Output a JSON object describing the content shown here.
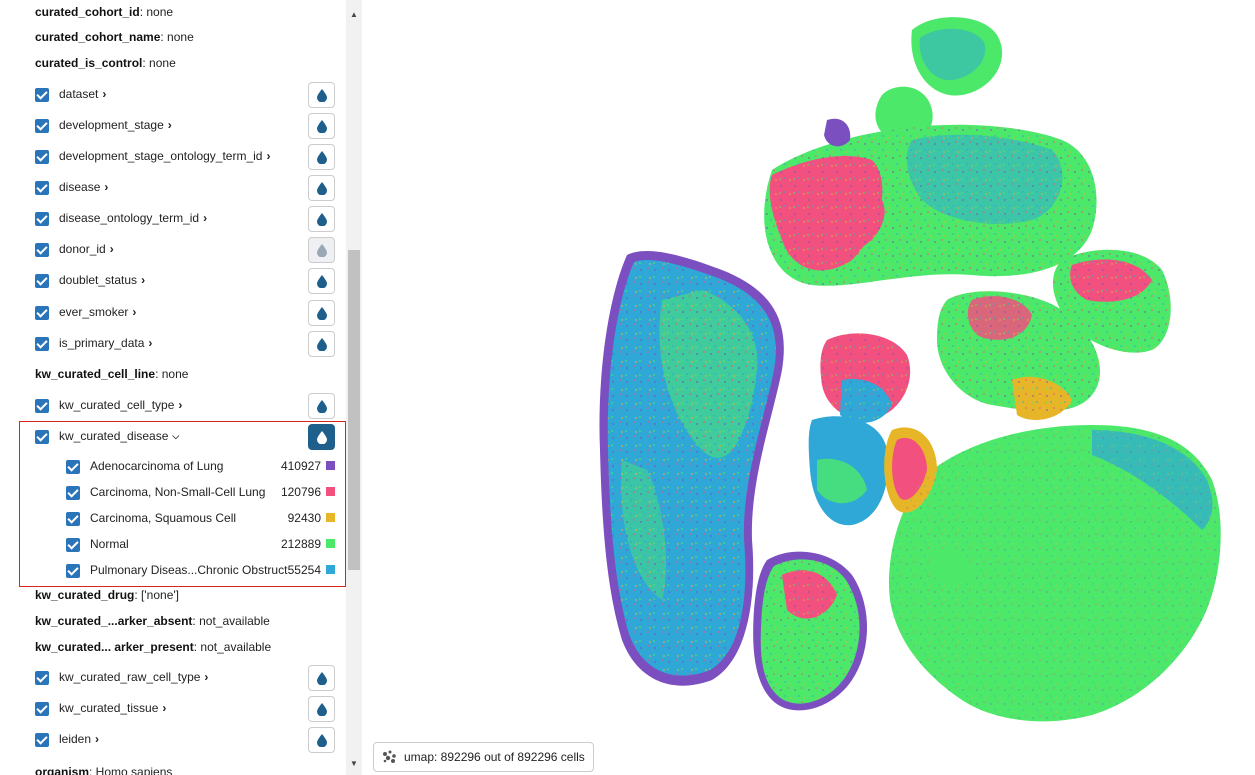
{
  "sidebar": {
    "partial_top": {
      "key": "curated_cohort_id",
      "value": ": none"
    },
    "curated_cohort_name": {
      "key": "curated_cohort_name",
      "value": ": none"
    },
    "curated_is_control": {
      "key": "curated_is_control",
      "value": ": none"
    },
    "fields": [
      {
        "label": "dataset"
      },
      {
        "label": "development_stage"
      },
      {
        "label": "development_stage_ontology_term_id"
      },
      {
        "label": "disease"
      },
      {
        "label": "disease_ontology_term_id"
      },
      {
        "label": "donor_id"
      },
      {
        "label": "doublet_status"
      },
      {
        "label": "ever_smoker"
      },
      {
        "label": "is_primary_data"
      }
    ],
    "kw_curated_cell_line": {
      "key": "kw_curated_cell_line",
      "value": ": none"
    },
    "kw_curated_cell_type": {
      "label": "kw_curated_cell_type"
    },
    "kw_curated_disease": {
      "label": "kw_curated_disease",
      "categories": [
        {
          "label": "Adenocarcinoma of Lung",
          "count": "410927",
          "color": "#7b4fc0"
        },
        {
          "label": "Carcinoma, Non-Small-Cell Lung",
          "count": "120796",
          "color": "#f2507f"
        },
        {
          "label": "Carcinoma, Squamous Cell",
          "count": "92430",
          "color": "#e6b628"
        },
        {
          "label": "Normal",
          "count": "212889",
          "color": "#4ce86a"
        },
        {
          "label": "Pulmonary Diseas...Chronic Obstructive",
          "count": "55254",
          "color": "#2fa8d8"
        }
      ]
    },
    "kw_curated_drug": {
      "key": "kw_curated_drug",
      "value": ": ['none']"
    },
    "kw_curated_marker_absent": {
      "key": "kw_curated_...arker_absent",
      "value": ": not_available"
    },
    "kw_curated_marker_present": {
      "key": "kw_curated... arker_present",
      "value": ": not_available"
    },
    "bottom_fields": [
      {
        "label": "kw_curated_raw_cell_type"
      },
      {
        "label": "kw_curated_tissue"
      },
      {
        "label": "leiden"
      }
    ],
    "partial_bottom": {
      "key": "organism",
      "value": ": Homo sapiens"
    }
  },
  "status": {
    "text": "umap: 892296 out of 892296 cells"
  },
  "colors": {
    "accent": "#2a74b9",
    "active_button": "#1f5f8b",
    "highlight_box": "#d9231f"
  },
  "icons": {
    "drop": "water-drop-icon",
    "chevron": "chevron-right-icon",
    "scatter": "scatter-plot-icon"
  }
}
